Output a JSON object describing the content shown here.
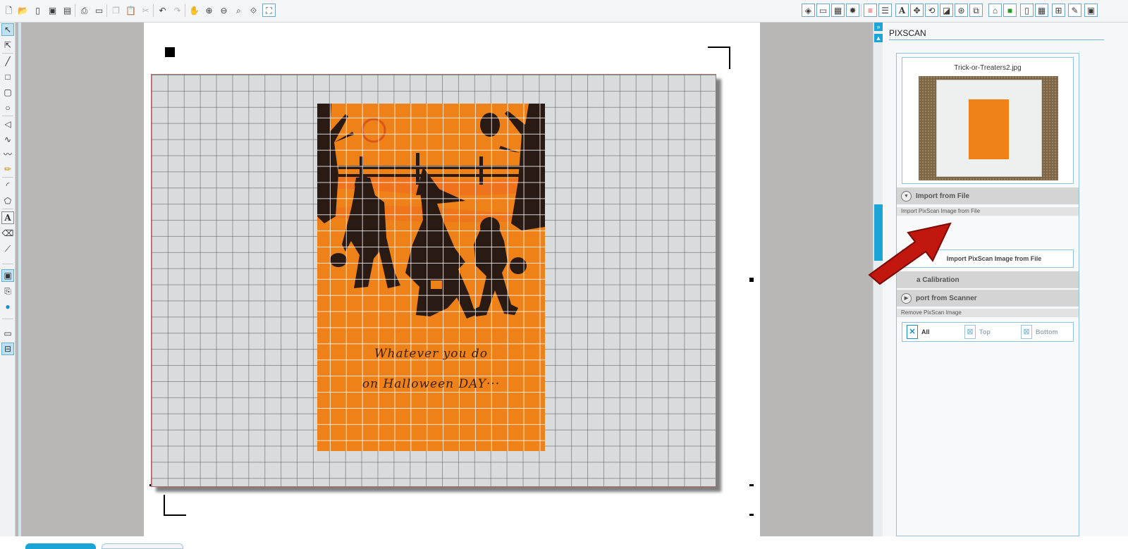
{
  "toolbar": {
    "left_icons": [
      "new-icon",
      "open-icon",
      "new-file-icon",
      "save-icon",
      "save-as-icon",
      "print-icon",
      "cut-settings-icon",
      "copy-icon",
      "paste-icon",
      "scissors-icon",
      "undo-icon",
      "redo-icon",
      "pan-hand-icon",
      "zoom-in-icon",
      "zoom-out-icon",
      "zoom-box-icon",
      "zoom-fit-icon"
    ],
    "right_icons": [
      "fill-icon",
      "window-icon",
      "grid-icon",
      "star-icon",
      "line-color-icon",
      "line-style-icon",
      "text-style-icon",
      "transform-icon",
      "replicate-icon",
      "weld-icon",
      "offset-icon",
      "trace-icon",
      "pixscan-icon",
      "library-icon",
      "page-icon",
      "grid-settings-icon",
      "cut-icon",
      "panel-expand-icon"
    ],
    "text_glyph": "A"
  },
  "left_toolbar": {
    "tools": [
      "select-icon",
      "point-edit-icon",
      "line-icon",
      "rectangle-icon",
      "rounded-rectangle-icon",
      "ellipse-icon",
      "polygon-icon",
      "curve-icon",
      "freehand-icon",
      "pencil-icon",
      "arc-icon",
      "regular-polygon-icon",
      "text-icon",
      "eraser-icon",
      "knife-icon",
      "design-view-icon",
      "library-view-icon",
      "store-icon",
      "single-window-icon",
      "split-window-icon"
    ],
    "text_glyph": "A"
  },
  "canvas": {
    "image_name": "Trick-or-Treaters2.jpg",
    "card_text_line1": "Whatever you do",
    "card_text_line2": "on Halloween DAY···",
    "card_color": "#ee8117",
    "mat_color": "#d9dcdd"
  },
  "panel": {
    "title": "PIXSCAN",
    "collapse_glyph": "»",
    "scroll_up_glyph": "▲",
    "thumbnail_label": "Trick-or-Treaters2.jpg",
    "sections": {
      "import_from_file": "Import from File",
      "import_file_sub": "Import PixScan Image from File",
      "import_button": "Import PixScan Image from File",
      "calibration": "a Calibration",
      "import_from_scanner": "port from Scanner",
      "remove_sub": "Remove PixScan Image"
    },
    "remove_options": [
      {
        "label": "All",
        "icon": "remove-all-icon"
      },
      {
        "label": "Top",
        "icon": "remove-top-icon"
      },
      {
        "label": "Bottom",
        "icon": "remove-bottom-icon"
      }
    ],
    "accent": "#1aa5d6",
    "arrow_color": "#c1170f"
  }
}
